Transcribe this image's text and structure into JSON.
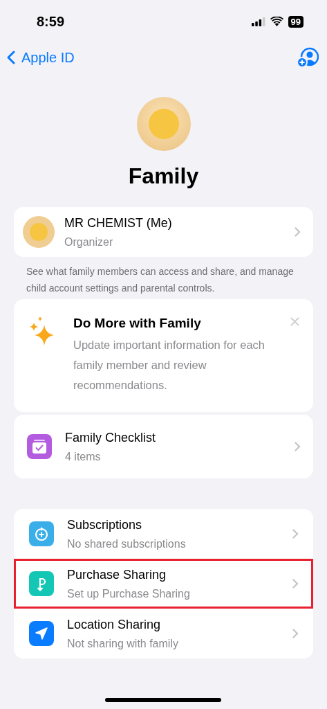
{
  "status_bar": {
    "time": "8:59",
    "battery": "99"
  },
  "nav": {
    "back": "Apple ID"
  },
  "title": "Family",
  "member": {
    "name": "MR CHEMIST (Me)",
    "role": "Organizer"
  },
  "footnote": "See what family members can access and share, and manage child account settings and parental controls.",
  "promo": {
    "title": "Do More with Family",
    "text": "Update important information for each family member and review recommendations."
  },
  "checklist": {
    "title": "Family Checklist",
    "subtitle": "4 items"
  },
  "services": [
    {
      "kind": "subscriptions",
      "title": "Subscriptions",
      "subtitle": "No shared subscriptions",
      "highlighted": false
    },
    {
      "kind": "purchase",
      "title": "Purchase Sharing",
      "subtitle": "Set up Purchase Sharing",
      "highlighted": true
    },
    {
      "kind": "location",
      "title": "Location Sharing",
      "subtitle": "Not sharing with family",
      "highlighted": false
    }
  ]
}
